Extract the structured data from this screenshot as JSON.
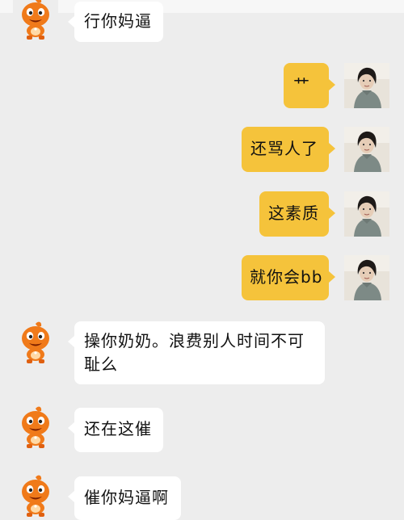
{
  "chat": {
    "messages": [
      {
        "side": "left",
        "sender": "bot",
        "text": "行你妈逼"
      },
      {
        "side": "right",
        "sender": "user",
        "text": "艹"
      },
      {
        "side": "right",
        "sender": "user",
        "text": "还骂人了"
      },
      {
        "side": "right",
        "sender": "user",
        "text": "这素质"
      },
      {
        "side": "right",
        "sender": "user",
        "text": "就你会bb"
      },
      {
        "side": "left",
        "sender": "bot",
        "text": "操你奶奶。浪费别人时间不可耻么"
      },
      {
        "side": "left",
        "sender": "bot",
        "text": "还在这催"
      },
      {
        "side": "left",
        "sender": "bot",
        "text": "催你妈逼啊"
      }
    ]
  },
  "colors": {
    "background": "#ededed",
    "user_bubble": "#f5c33b",
    "bot_bubble": "#ffffff",
    "bot_avatar": "#f07a1a"
  },
  "icons": {
    "bot_avatar": "orange-mascot-avatar-icon",
    "user_avatar": "user-photo-avatar"
  }
}
